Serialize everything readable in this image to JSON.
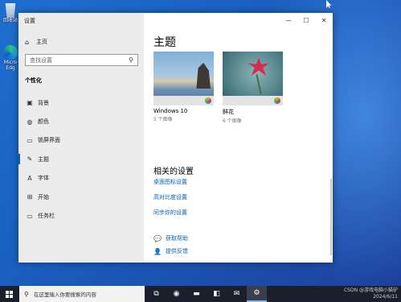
{
  "desktop": {
    "icons": [
      {
        "label": "回收站",
        "icon": "recycle-bin-icon"
      },
      {
        "label": "Micro Edg",
        "icon": "edge-icon"
      }
    ]
  },
  "window": {
    "title": "设置",
    "controls": {
      "minimize": "—",
      "maximize": "☐",
      "close": "✕"
    }
  },
  "sidebar": {
    "home_label": "主页",
    "search_placeholder": "查找设置",
    "section_title": "个性化",
    "items": [
      {
        "label": "背景",
        "icon": "image-icon"
      },
      {
        "label": "颜色",
        "icon": "palette-icon"
      },
      {
        "label": "锁屏界面",
        "icon": "lock-screen-icon"
      },
      {
        "label": "主题",
        "icon": "theme-icon",
        "active": true
      },
      {
        "label": "字体",
        "icon": "font-icon"
      },
      {
        "label": "开始",
        "icon": "start-icon"
      },
      {
        "label": "任务栏",
        "icon": "taskbar-icon"
      }
    ]
  },
  "main": {
    "title": "主题",
    "themes": [
      {
        "name": "Windows 10",
        "count": "5 个图像"
      },
      {
        "name": "鲜花",
        "count": "6 个图像"
      }
    ],
    "related_title": "相关的设置",
    "related_links": [
      "桌面图标设置",
      "高对比度设置",
      "同步你的设置"
    ],
    "help": [
      {
        "label": "获取帮助",
        "icon": "help-icon"
      },
      {
        "label": "提供反馈",
        "icon": "feedback-icon"
      }
    ]
  },
  "taskbar": {
    "search_placeholder": "在这里输入你要搜索的内容",
    "apps": [
      {
        "icon": "task-view-icon",
        "glyph": "⧉"
      },
      {
        "icon": "edge-icon",
        "glyph": "◉"
      },
      {
        "icon": "file-explorer-icon",
        "glyph": "▬"
      },
      {
        "icon": "store-icon",
        "glyph": "◧"
      },
      {
        "icon": "mail-icon",
        "glyph": "✉"
      },
      {
        "icon": "settings-icon",
        "glyph": "⚙",
        "active": true
      }
    ],
    "tray_text": "CSDN @游戏电脑小猫驴",
    "date": "2024/6/11"
  }
}
